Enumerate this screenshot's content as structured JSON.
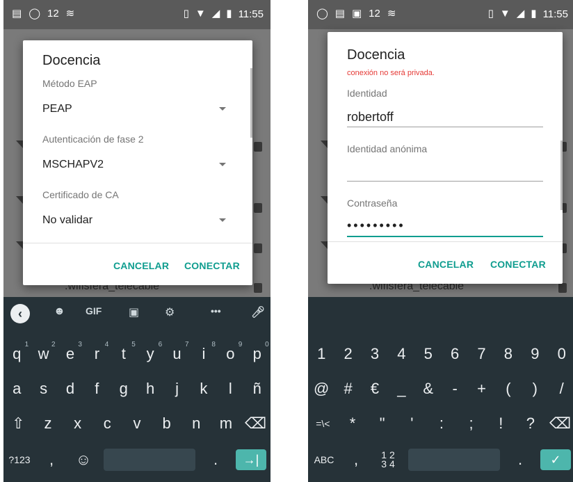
{
  "status_bar": {
    "left": {
      "time": "11:55"
    },
    "right": {
      "time": "11:55"
    },
    "notif_text": "12"
  },
  "background": {
    "network_name": ".wifisfera_telecable"
  },
  "left_dialog": {
    "title": "Docencia",
    "eap_label": "Método EAP",
    "eap_value": "PEAP",
    "phase2_label": "Autenticación de fase 2",
    "phase2_value": "MSCHAPV2",
    "ca_label": "Certificado de CA",
    "ca_value": "No validar",
    "cancel": "CANCELAR",
    "connect": "CONECTAR"
  },
  "right_dialog": {
    "title": "Docencia",
    "warning": "conexión no será privada.",
    "identity_label": "Identidad",
    "identity_value": "robertoff",
    "anon_label": "Identidad anónima",
    "anon_value": "",
    "password_label": "Contraseña",
    "password_value": "•••••••••",
    "cancel": "CANCELAR",
    "connect": "CONECTAR"
  },
  "keyboard_letters": {
    "toolbar": {
      "gif": "GIF",
      "more": "•••"
    },
    "row1": [
      {
        "k": "q",
        "s": "1"
      },
      {
        "k": "w",
        "s": "2"
      },
      {
        "k": "e",
        "s": "3"
      },
      {
        "k": "r",
        "s": "4"
      },
      {
        "k": "t",
        "s": "5"
      },
      {
        "k": "y",
        "s": "6"
      },
      {
        "k": "u",
        "s": "7"
      },
      {
        "k": "i",
        "s": "8"
      },
      {
        "k": "o",
        "s": "9"
      },
      {
        "k": "p",
        "s": "0"
      }
    ],
    "row2": [
      "a",
      "s",
      "d",
      "f",
      "g",
      "h",
      "j",
      "k",
      "l",
      "ñ"
    ],
    "row3": [
      "⇧",
      "z",
      "x",
      "c",
      "v",
      "b",
      "n",
      "m",
      "⌫"
    ],
    "row4": {
      "sym": "?123",
      "comma": ",",
      "emoji": "☺",
      "period": ".",
      "enter": "→|"
    }
  },
  "keyboard_symbols": {
    "row1": [
      "1",
      "2",
      "3",
      "4",
      "5",
      "6",
      "7",
      "8",
      "9",
      "0"
    ],
    "row2": [
      "@",
      "#",
      "€",
      "_",
      "&",
      "-",
      "+",
      "(",
      ")",
      "/"
    ],
    "row3": [
      "=\\<",
      "*",
      "\"",
      "'",
      ":",
      ";",
      "!",
      "?",
      "⌫"
    ],
    "row4": {
      "abc": "ABC",
      "comma": ",",
      "frac": "1 2\n3 4",
      "period": ".",
      "enter": "✓"
    }
  }
}
